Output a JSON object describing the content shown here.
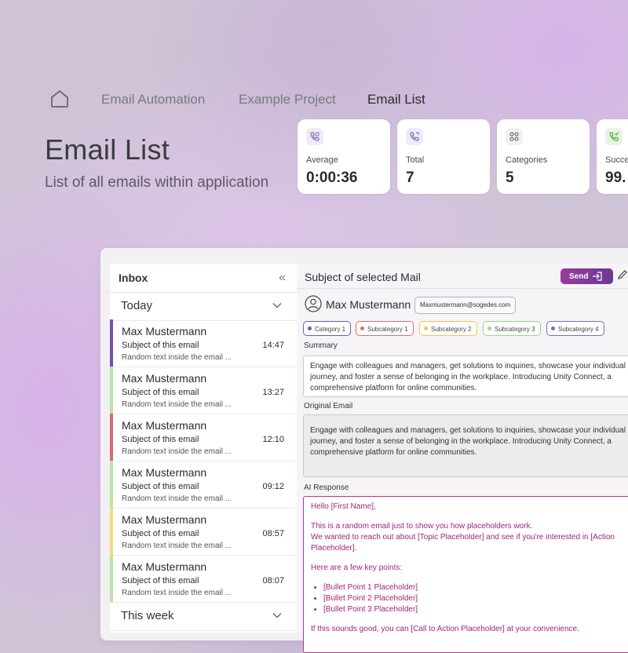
{
  "breadcrumb": {
    "items": [
      "Email Automation",
      "Example Project",
      "Email List"
    ]
  },
  "page": {
    "title": "Email List",
    "subtitle": "List of all emails within application"
  },
  "stats": [
    {
      "label": "Average",
      "value": "0:00:36",
      "icon": "phone-clock-icon"
    },
    {
      "label": "Total",
      "value": "7",
      "icon": "phone-icon"
    },
    {
      "label": "Categories",
      "value": "5",
      "icon": "grid-icon"
    },
    {
      "label": "Succes",
      "value": "99.",
      "icon": "phone-check-icon"
    }
  ],
  "inbox": {
    "title": "Inbox",
    "groups": [
      "Today",
      "This week"
    ],
    "mails": [
      {
        "name": "Max Mustermann",
        "subject": "Subject of this email",
        "time": "14:47",
        "preview": "Random text inside the email ...",
        "color": "#7b4bb0"
      },
      {
        "name": "Max Mustermann",
        "subject": "Subject of this email",
        "time": "13:27",
        "preview": "Random text inside the email ...",
        "color": "#b7e6a6"
      },
      {
        "name": "Max Mustermann",
        "subject": "Subject of this email",
        "time": "12:10",
        "preview": "Random text inside the email ...",
        "color": "#d96a6f"
      },
      {
        "name": "Max Mustermann",
        "subject": "Subject of this email",
        "time": "09:12",
        "preview": "Random text inside the email ...",
        "color": "#b7e6a6"
      },
      {
        "name": "Max Mustermann",
        "subject": "Subject of this email",
        "time": "08:57",
        "preview": "Random text inside the email ...",
        "color": "#f3dc78"
      },
      {
        "name": "Max Mustermann",
        "subject": "Subject of this email",
        "time": "08:07",
        "preview": "Random text inside the email ...",
        "color": "#b7e6a6"
      }
    ]
  },
  "detail": {
    "subject": "Subject of selected Mail",
    "send_label": "Send",
    "sender": "Max Mustermann",
    "sender_email": "Maxmustermann@sogedes.com",
    "categories": [
      {
        "label": "Category 1",
        "color": "#6b5bb5"
      },
      {
        "label": "Subcategory 1",
        "color": "#e0706a"
      },
      {
        "label": "Subcategory 2",
        "color": "#f0c94a"
      },
      {
        "label": "Subcategory 3",
        "color": "#9ed48a"
      },
      {
        "label": "Subcategory 4",
        "color": "#7a6bc0"
      }
    ],
    "summary_label": "Summary",
    "summary_text": "Engage with colleagues and managers, get solutions to inquiries, showcase your individual journey, and foster a sense of belonging in the workplace. Introducing Unity Connect, a comprehensive platform for online communities.",
    "original_label": "Original Email",
    "original_text": "Engage with colleagues and managers, get solutions to inquiries, showcase your individual journey, and foster a sense of belonging in the workplace. Introducing Unity Connect, a comprehensive platform for online communities.",
    "ai_label": "AI Response",
    "ai": {
      "greeting": "Hello [First Name],",
      "line1": "This is a random email just to show you how placeholders work.",
      "line2": " We wanted to reach out about [Topic Placeholder] and see if you're interested in [Action Placeholder].",
      "points_intro": "Here are a few key points:",
      "bullets": [
        "[Bullet Point 1 Placeholder]",
        "[Bullet Point 2 Placeholder]",
        "[Bullet Point 3 Placeholder]"
      ],
      "closing": "If this sounds good, you can [Call to Action Placeholder] at your convenience."
    }
  },
  "colors": {
    "accent": "#9a3a9a",
    "ai_text": "#a0247c"
  }
}
